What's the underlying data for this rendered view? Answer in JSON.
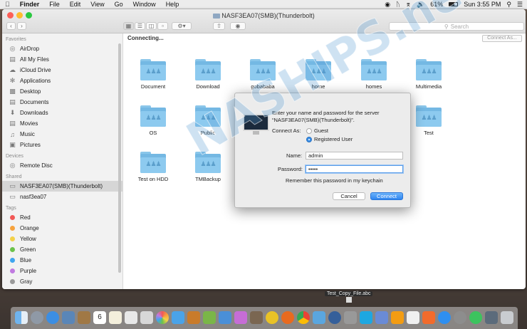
{
  "menubar": {
    "apple_icon": "apple-icon",
    "app_name": "Finder",
    "menus": [
      "File",
      "Edit",
      "View",
      "Go",
      "Window",
      "Help"
    ],
    "battery_percent": "61%",
    "clock": "Sun 3:55 PM"
  },
  "window": {
    "title": "NASF3EA07(SMB)(Thunderbolt)",
    "search_placeholder": "Search",
    "status": "Connecting...",
    "connect_as_button": "Connect As..."
  },
  "sidebar": {
    "favorites_header": "Favorites",
    "favorites": [
      {
        "label": "AirDrop",
        "icon": "airdrop-icon"
      },
      {
        "label": "All My Files",
        "icon": "all-files-icon"
      },
      {
        "label": "iCloud Drive",
        "icon": "cloud-icon"
      },
      {
        "label": "Applications",
        "icon": "applications-icon"
      },
      {
        "label": "Desktop",
        "icon": "desktop-icon"
      },
      {
        "label": "Documents",
        "icon": "documents-icon"
      },
      {
        "label": "Downloads",
        "icon": "downloads-icon"
      },
      {
        "label": "Movies",
        "icon": "movies-icon"
      },
      {
        "label": "Music",
        "icon": "music-icon"
      },
      {
        "label": "Pictures",
        "icon": "pictures-icon"
      }
    ],
    "devices_header": "Devices",
    "devices": [
      {
        "label": "Remote Disc",
        "icon": "disc-icon"
      }
    ],
    "shared_header": "Shared",
    "shared": [
      {
        "label": "NASF3EA07(SMB)(Thunderbolt)",
        "icon": "server-icon",
        "selected": true
      },
      {
        "label": "nasf3ea07",
        "icon": "server-icon",
        "selected": false
      }
    ],
    "tags_header": "Tags",
    "tags": [
      {
        "label": "Red",
        "color": "#f25856"
      },
      {
        "label": "Orange",
        "color": "#f6a23d"
      },
      {
        "label": "Yellow",
        "color": "#f3d14a"
      },
      {
        "label": "Green",
        "color": "#6cc24a"
      },
      {
        "label": "Blue",
        "color": "#3fa5ef"
      },
      {
        "label": "Purple",
        "color": "#c07ae0"
      },
      {
        "label": "Gray",
        "color": "#9a9a9a"
      }
    ]
  },
  "folders": [
    "Document",
    "Download",
    "gobababa",
    "home",
    "homes",
    "Multimedia",
    "OS",
    "Public",
    "Test",
    "Test on HDD",
    "TMBackup"
  ],
  "dialog": {
    "prompt_line1": "Enter your name and password for the server",
    "prompt_line2": "“NASF3EA07(SMB)(Thunderbolt)”.",
    "connect_as_label": "Connect As:",
    "guest_label": "Guest",
    "registered_label": "Registered User",
    "name_label": "Name:",
    "name_value": "admin",
    "password_label": "Password:",
    "password_value": "•••••",
    "remember_label": "Remember this password in my keychain",
    "cancel_button": "Cancel",
    "connect_button": "Connect"
  },
  "watermark": "NASHIPS.net",
  "desktop_file": "Test_Copy_File.abc",
  "dock": {
    "calendar_day": "6"
  }
}
